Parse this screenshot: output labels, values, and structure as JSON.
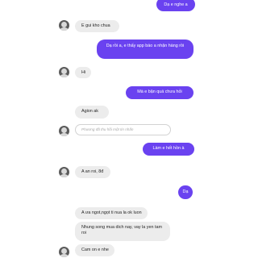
{
  "messages": [
    {
      "from": "me",
      "text": "Dạ e nghe a"
    },
    {
      "from": "them",
      "text": "E gui kho chua"
    },
    {
      "from": "me",
      "text": "Dạ rồi a, e thấy app báo a nhận hàng rồi"
    },
    {
      "from": "them",
      "text": "Hi"
    },
    {
      "from": "me",
      "text": "Mà e bận quá chưa hỏi"
    },
    {
      "from": "them",
      "text": "Agion ak"
    },
    {
      "from": "them",
      "text": "A an roi, 8đ"
    },
    {
      "from": "me",
      "text": "Làm e hết hồn à"
    },
    {
      "from": "me",
      "text": "Dạ"
    },
    {
      "from": "them",
      "text": "A ưa ngot,ngọt ti nua la ok luon"
    },
    {
      "from": "them",
      "text": "Nhung song mua dich nay, vay la yen tam roi"
    },
    {
      "from": "them",
      "text": "Cam on e nhe"
    }
  ],
  "reply_placeholder": "Phương đã thu hồi một tin nhắn",
  "colors": {
    "outgoing": "#6a42f0",
    "incoming": "#ececec"
  }
}
